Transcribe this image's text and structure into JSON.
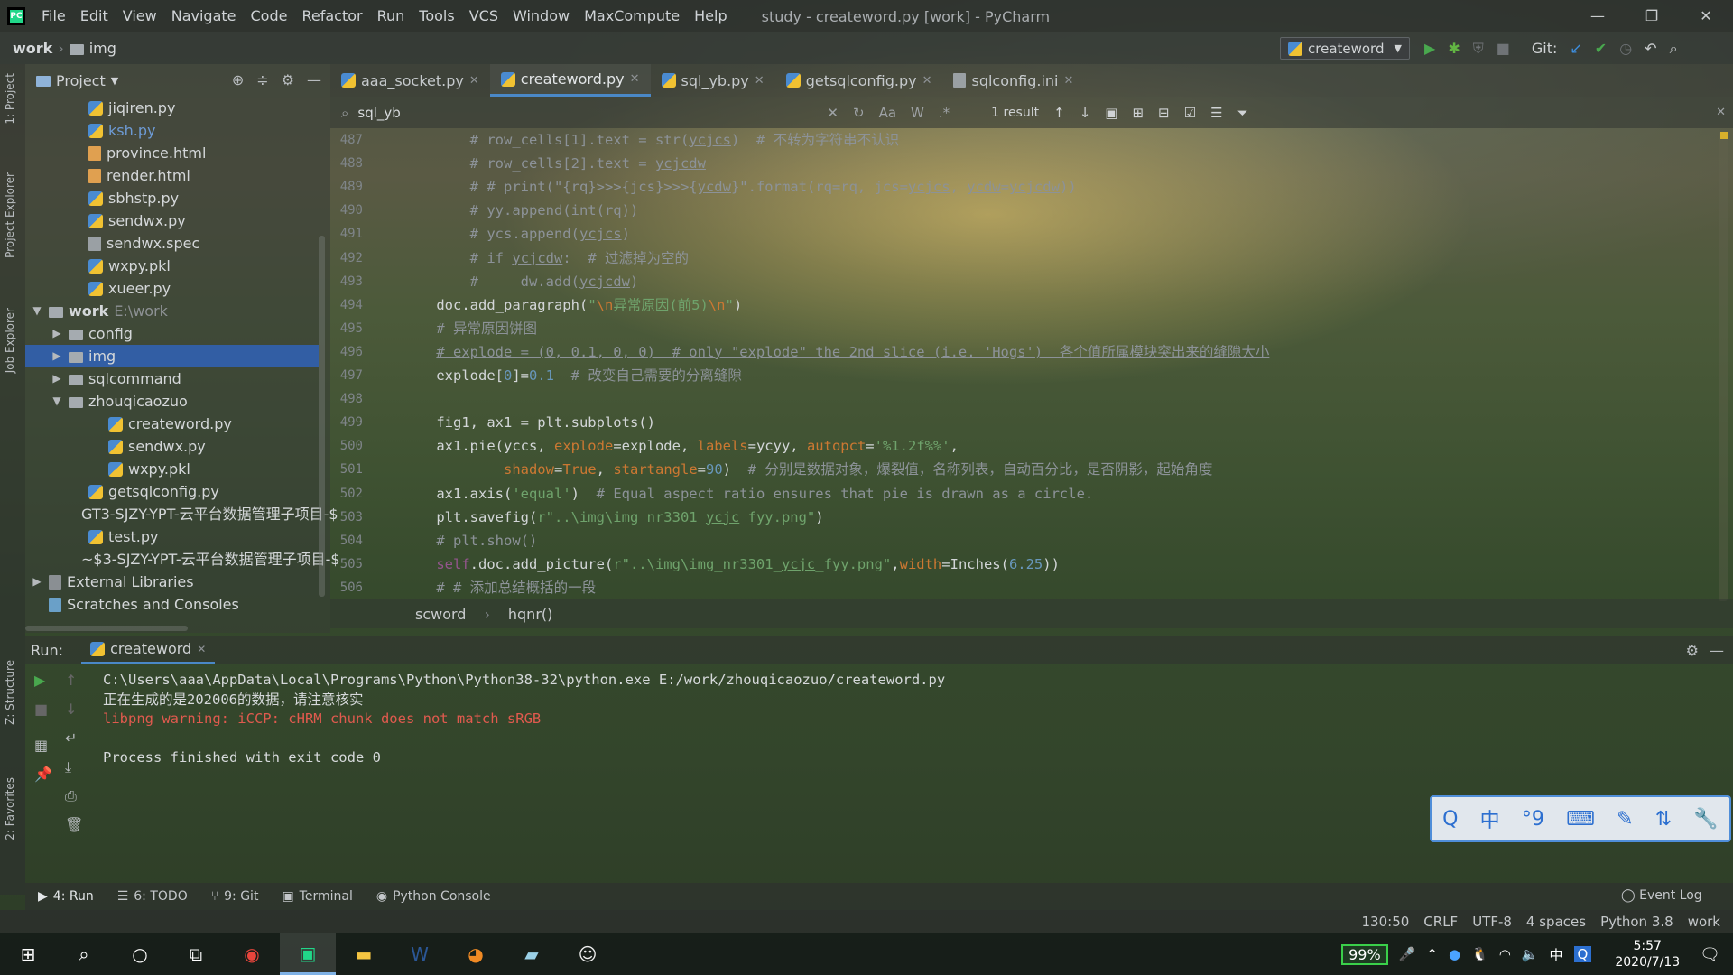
{
  "app": {
    "menu": [
      "File",
      "Edit",
      "View",
      "Navigate",
      "Code",
      "Refactor",
      "Run",
      "Tools",
      "VCS",
      "Window",
      "MaxCompute",
      "Help"
    ],
    "title": "study - createword.py [work] - PyCharm",
    "logo_text": "PC"
  },
  "nav": {
    "crumbs": [
      "work",
      "img"
    ],
    "run_config": "createword",
    "git_label": "Git:"
  },
  "left_stripe": {
    "project_tab": "1: Project",
    "explorer_tab": "Project Explorer",
    "job_tab": "Job Explorer",
    "structure_tab": "Z: Structure",
    "favorites_tab": "2: Favorites"
  },
  "project": {
    "title": "Project",
    "tree": [
      {
        "label": "jiqiren.py",
        "type": "py",
        "depth": 2
      },
      {
        "label": "ksh.py",
        "type": "py",
        "depth": 2,
        "color": "#6d9ad4"
      },
      {
        "label": "province.html",
        "type": "html",
        "depth": 2
      },
      {
        "label": "render.html",
        "type": "html",
        "depth": 2
      },
      {
        "label": "sbhstp.py",
        "type": "py",
        "depth": 2
      },
      {
        "label": "sendwx.py",
        "type": "py",
        "depth": 2
      },
      {
        "label": "sendwx.spec",
        "type": "file",
        "depth": 2
      },
      {
        "label": "wxpy.pkl",
        "type": "py",
        "depth": 2
      },
      {
        "label": "xueer.py",
        "type": "py",
        "depth": 2
      },
      {
        "label": "work",
        "suffix": "E:\\work",
        "type": "folder",
        "depth": 0,
        "arrow": "▼",
        "bold": true
      },
      {
        "label": "config",
        "type": "folder",
        "depth": 1,
        "arrow": "▶"
      },
      {
        "label": "img",
        "type": "folder",
        "depth": 1,
        "arrow": "▶",
        "selected": true
      },
      {
        "label": "sqlcommand",
        "type": "folder",
        "depth": 1,
        "arrow": "▶"
      },
      {
        "label": "zhouqicaozuo",
        "type": "folder",
        "depth": 1,
        "arrow": "▼"
      },
      {
        "label": "createword.py",
        "type": "py",
        "depth": 3
      },
      {
        "label": "sendwx.py",
        "type": "py",
        "depth": 3
      },
      {
        "label": "wxpy.pkl",
        "type": "py",
        "depth": 3
      },
      {
        "label": "getsqlconfig.py",
        "type": "py",
        "depth": 2
      },
      {
        "label": "GT3-SJZY-YPT-云平台数据管理子项目-$",
        "type": "py",
        "depth": 2
      },
      {
        "label": "test.py",
        "type": "py",
        "depth": 2
      },
      {
        "label": "~$3-SJZY-YPT-云平台数据管理子项目-$",
        "type": "py",
        "depth": 2
      },
      {
        "label": "External Libraries",
        "type": "lib",
        "depth": 0,
        "arrow": "▶"
      },
      {
        "label": "Scratches and Consoles",
        "type": "scratch",
        "depth": 0
      }
    ]
  },
  "tabs": [
    {
      "label": "aaa_socket.py",
      "icon": "py"
    },
    {
      "label": "createword.py",
      "icon": "py",
      "active": true
    },
    {
      "label": "sql_yb.py",
      "icon": "py"
    },
    {
      "label": "getsqlconfig.py",
      "icon": "py"
    },
    {
      "label": "sqlconfig.ini",
      "icon": "file",
      "noclose": true
    }
  ],
  "search": {
    "query": "sql_yb",
    "results": "1 result",
    "opts": [
      "Aa",
      "W",
      ".*"
    ]
  },
  "editor": {
    "line_numbers": [
      "487",
      "488",
      "489",
      "490",
      "491",
      "492",
      "493",
      "494",
      "495",
      "496",
      "497",
      "498",
      "499",
      "500",
      "501",
      "502",
      "503",
      "504",
      "505",
      "506"
    ],
    "code_html": [
      "        <span class='cm'># row_cells[1].text = str(<span class='ul'>ycjcs</span>)  # 不转为字符串不认识</span>",
      "        <span class='cm'># row_cells[2].text = <span class='ul'>ycjcdw</span></span>",
      "        <span class='cm'># # print(\"{rq}>>>{jcs}>>>{<span class='ul'>ycdw</span>}\".format(rq=rq, jcs=<span class='ul'>ycjcs</span>, <span class='ul'>ycdw</span>=<span class='ul'>ycjcdw</span>))</span>",
      "        <span class='cm'># yy.append(int(rq))</span>",
      "        <span class='cm'># ycs.append(<span class='ul'>ycjcs</span>)</span>",
      "        <span class='cm'># if <span class='ul'>ycjcdw</span>:  # 过滤掉为空的</span>",
      "        <span class='cm'>#     dw.add(<span class='ul'>ycjcdw</span>)</span>",
      "    doc.add_paragraph(<span class='str'>\"<span class='kw'>\\n</span>异常原因(前5)<span class='kw'>\\n</span>\"</span>)",
      "    <span class='cm'># 异常原因饼图</span>",
      "    <span class='cm-u'># explode = (0, 0.1, 0, 0)  # only \"explode\" the 2nd slice (i.e. 'Hogs')  各个值所属模块突出来的缝隙大小</span>",
      "    explode[<span class='num'>0</span>]=<span class='num'>0.1</span>  <span class='cm'># 改变自己需要的分离缝隙</span>",
      "",
      "    fig1, ax1 = plt.subplots()",
      "    ax1.pie(yccs, <span class='kw'>explode</span>=explode, <span class='kw'>labels</span>=ycyy, <span class='kw'>autopct</span>=<span class='str'>'%1.2f%%'</span>,",
      "            <span class='kw'>shadow</span>=<span class='kw'>True</span>, <span class='kw'>startangle</span>=<span class='num'>90</span>)  <span class='cm'># 分别是数据对象，爆裂值，名称列表，自动百分比，是否阴影，起始角度</span>",
      "    ax1.axis(<span class='str'>'equal'</span>)  <span class='cm'># Equal aspect ratio ensures that pie is drawn as a circle.</span>",
      "    plt.savefig(<span class='str'>r\"..\\img\\img_nr3301_<span class='ul'>ycjc</span>_fyy.png\"</span>)",
      "    <span class='cm'># plt.show()</span>",
      "    <span class='self'>self</span>.doc.add_picture(<span class='str'>r\"..\\img\\img_nr3301_<span class='ul'>ycjc</span>_fyy.png\"</span>,<span class='kw'>width</span>=Inches(<span class='num'>6.25</span>))",
      "    <span class='cm'># # 添加总结概括的一段</span>"
    ]
  },
  "code_crumbs": [
    "scword",
    "hqnr()"
  ],
  "run": {
    "label": "Run:",
    "tab": "createword",
    "console": [
      {
        "text": "C:\\Users\\aaa\\AppData\\Local\\Programs\\Python\\Python38-32\\python.exe E:/work/zhouqicaozuo/createword.py",
        "err": false
      },
      {
        "text": "正在生成的是202006的数据，请注意核实",
        "err": false
      },
      {
        "text": "libpng warning: iCCP: cHRM chunk does not match sRGB",
        "err": true
      },
      {
        "text": "",
        "err": false
      },
      {
        "text": "Process finished with exit code 0",
        "err": false
      }
    ]
  },
  "ime": {
    "icons": [
      "Q",
      "中",
      "°9",
      "⌨",
      "✎",
      "⇅",
      "🔧"
    ]
  },
  "bottom_tabs": [
    {
      "label": "4: Run",
      "icon": "▶",
      "active": true
    },
    {
      "label": "6: TODO",
      "icon": "☰"
    },
    {
      "label": "9: Git",
      "icon": "⑂"
    },
    {
      "label": "Terminal",
      "icon": "▣"
    },
    {
      "label": "Python Console",
      "icon": "◉"
    }
  ],
  "event_log": "Event Log",
  "status": [
    "130:50",
    "CRLF",
    "UTF-8",
    "4 spaces",
    "Python 3.8",
    "work"
  ],
  "taskbar": {
    "battery": "99%",
    "ime_char": "中",
    "time": "5:57",
    "date": "2020/7/13"
  }
}
